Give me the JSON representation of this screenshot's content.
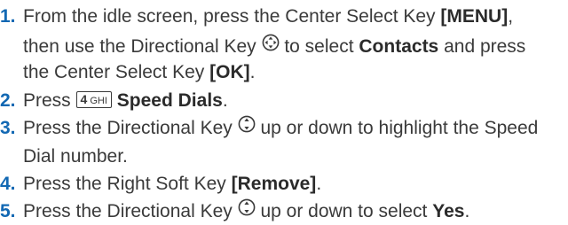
{
  "steps": [
    {
      "number": "1.",
      "line1": {
        "text": "From the idle screen, press the Center Select Key ",
        "bold": "[MENU]",
        "after": ","
      },
      "line2": {
        "before": "then use the Directional Key ",
        "after": " to select ",
        "bold": "Contacts",
        "tail": " and press"
      },
      "line3": {
        "text": "the Center Select Key ",
        "bold": "[OK]",
        "after": "."
      }
    },
    {
      "number": "2.",
      "before": "Press ",
      "key_digit": "4",
      "key_letters": "GHI",
      "bold": "Speed Dials",
      "after": "."
    },
    {
      "number": "3.",
      "line1": {
        "before": "Press the Directional Key ",
        "after": " up or down to highlight the Speed"
      },
      "line2": {
        "text": "Dial number."
      }
    },
    {
      "number": "4.",
      "text": "Press the Right Soft Key ",
      "bold": "[Remove]",
      "after": "."
    },
    {
      "number": "5.",
      "before": "Press the Directional Key ",
      "after": " up or down to select ",
      "bold": "Yes",
      "tail": "."
    }
  ],
  "icons": {
    "nav_all": "directional-key-four-way-icon",
    "nav_updown": "directional-key-up-down-icon",
    "key_4": "keypad-4-ghi-icon"
  },
  "colors": {
    "step_number": "#1268b3",
    "body_text": "#3a3a3a"
  }
}
